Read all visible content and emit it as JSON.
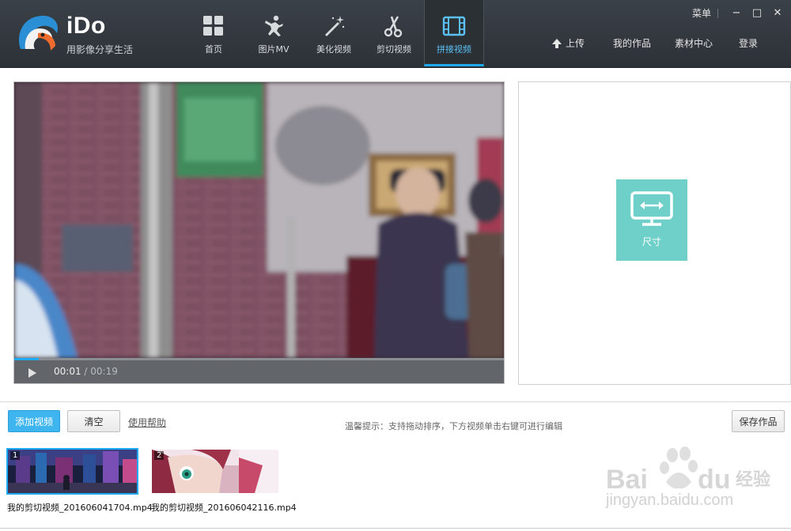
{
  "app": {
    "brand": "iDo",
    "slogan": "用影像分享生活"
  },
  "nav": {
    "items": [
      {
        "label": "首页",
        "icon": "grid-icon"
      },
      {
        "label": "图片MV",
        "icon": "dancer-icon"
      },
      {
        "label": "美化视频",
        "icon": "magic-wand-icon"
      },
      {
        "label": "剪切视频",
        "icon": "scissors-icon"
      },
      {
        "label": "拼接视频",
        "icon": "film-strip-icon",
        "active": true
      }
    ]
  },
  "window": {
    "menu_label": "菜单",
    "minimize": "−",
    "maximize": "□",
    "close": "✕"
  },
  "account": {
    "upload_label": "上传",
    "works_label": "我的作品",
    "material_label": "素材中心",
    "login_label": "登录"
  },
  "player": {
    "current_time": "00:01",
    "separator": " / ",
    "total_time": "00:19",
    "progress": 0.05
  },
  "panel": {
    "size_label": "尺寸"
  },
  "toolbar": {
    "add_label": "添加视频",
    "clear_label": "清空",
    "help_label": "使用帮助",
    "tip": "温馨提示：支持拖动排序，下方视频单击右键可进行编辑",
    "save_label": "保存作品"
  },
  "clips": [
    {
      "index": "1",
      "name": "我的剪切视频_201606041704.mp4",
      "selected": true
    },
    {
      "index": "2",
      "name": "我的剪切视频_201606042116.mp4",
      "selected": false
    }
  ],
  "watermark": {
    "text": "jingyan.baidu.com"
  },
  "colors": {
    "accent": "#1eaaf1",
    "header_bg": "#2c3137",
    "size_button": "#6ed0c9"
  }
}
